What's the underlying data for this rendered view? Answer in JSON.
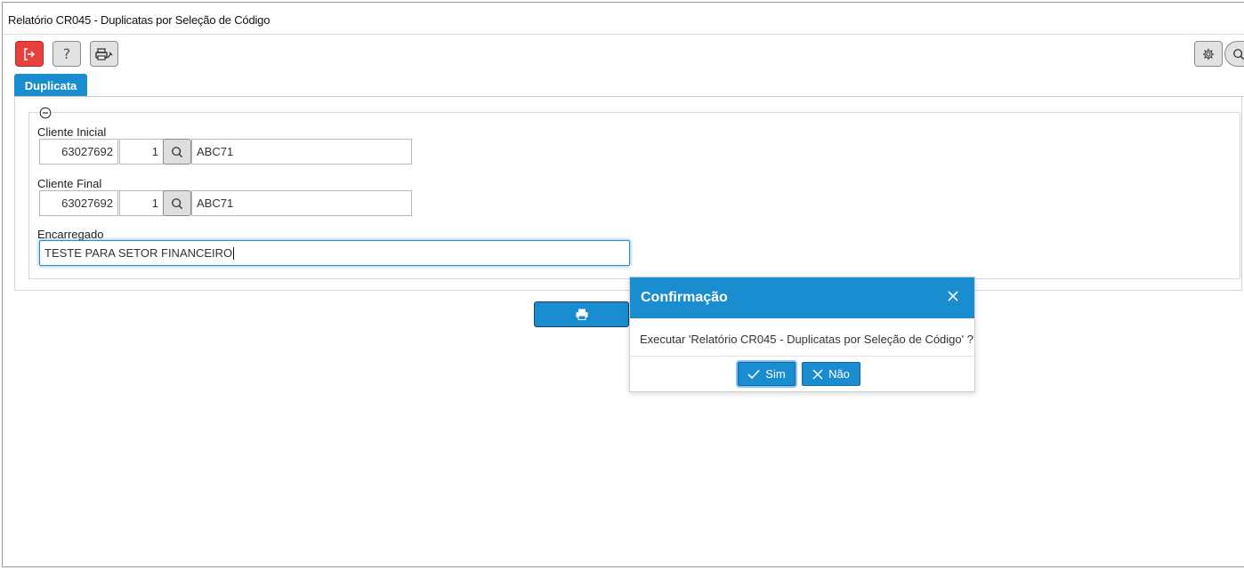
{
  "window": {
    "title": "Relatório CR045 - Duplicatas por Seleção de Código"
  },
  "toolbar": {
    "exit_icon": "exit-icon",
    "help_glyph": "?",
    "printer_setup_icon": "printer-settings-icon",
    "settings_icon": "gear-icon",
    "search_icon": "search-icon"
  },
  "tabs": [
    {
      "label": "Duplicata",
      "active": true
    }
  ],
  "form": {
    "cliente_inicial": {
      "label": "Cliente Inicial",
      "code": "63027692",
      "seq": "1",
      "name": "ABC71"
    },
    "cliente_final": {
      "label": "Cliente Final",
      "code": "63027692",
      "seq": "1",
      "name": "ABC71"
    },
    "encarregado": {
      "label": "Encarregado",
      "value": "TESTE PARA SETOR FINANCEIRO"
    }
  },
  "actions": {
    "print_icon": "printer-icon"
  },
  "dialog": {
    "title": "Confirmação",
    "message": "Executar 'Relatório CR045 - Duplicatas por Seleção de Código' ?",
    "yes_label": "Sim",
    "no_label": "Não"
  },
  "colors": {
    "accent": "#1a8dd0",
    "exit_button": "#e8413c"
  }
}
